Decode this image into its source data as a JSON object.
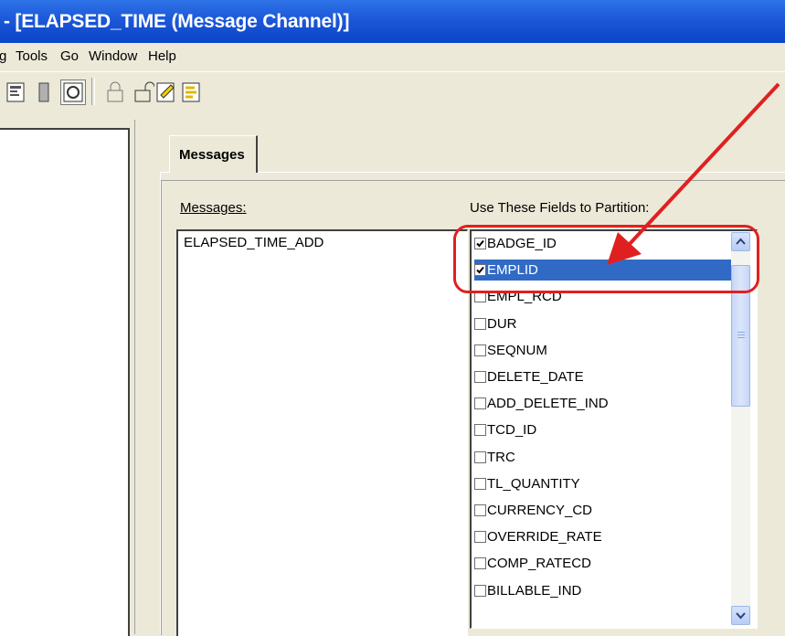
{
  "window": {
    "title": "- [ELAPSED_TIME (Message Channel)]"
  },
  "menu": [
    "g",
    "Tools",
    "Go",
    "Window",
    "Help"
  ],
  "toolbar": {
    "buttons": [
      "properties-icon",
      "database-icon",
      "message-channel-icon",
      "lock-icon",
      "unlock-icon",
      "edit-icon",
      "run-icon"
    ]
  },
  "tabs": {
    "active": "Messages"
  },
  "panel": {
    "messages_label": "Messages:",
    "fields_label": "Use These Fields to Partition:",
    "messages": [
      "ELAPSED_TIME_ADD"
    ],
    "fields": [
      {
        "name": "BADGE_ID",
        "checked": true,
        "selected": false
      },
      {
        "name": "EMPLID",
        "checked": true,
        "selected": true
      },
      {
        "name": "EMPL_RCD",
        "checked": false,
        "selected": false
      },
      {
        "name": "DUR",
        "checked": false,
        "selected": false
      },
      {
        "name": "SEQNUM",
        "checked": false,
        "selected": false
      },
      {
        "name": "DELETE_DATE",
        "checked": false,
        "selected": false
      },
      {
        "name": "ADD_DELETE_IND",
        "checked": false,
        "selected": false
      },
      {
        "name": "TCD_ID",
        "checked": false,
        "selected": false
      },
      {
        "name": "TRC",
        "checked": false,
        "selected": false
      },
      {
        "name": "TL_QUANTITY",
        "checked": false,
        "selected": false
      },
      {
        "name": "CURRENCY_CD",
        "checked": false,
        "selected": false
      },
      {
        "name": "OVERRIDE_RATE",
        "checked": false,
        "selected": false
      },
      {
        "name": "COMP_RATECD",
        "checked": false,
        "selected": false
      },
      {
        "name": "BILLABLE_IND",
        "checked": false,
        "selected": false
      }
    ]
  },
  "colors": {
    "title_bar": "#1c58d8",
    "selection": "#316ac5",
    "annotation": "#e02020",
    "window_bg": "#ece9d8"
  }
}
